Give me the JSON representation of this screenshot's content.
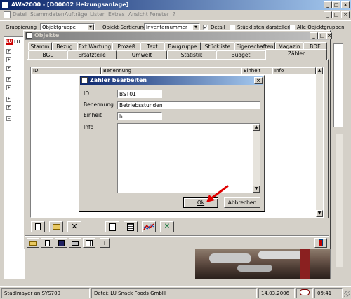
{
  "main_window": {
    "title": "AWa2000 - [D00002 Heizungsanlage]",
    "menu": [
      "Datei",
      "Stammdaten",
      "Aufträge",
      "Listen",
      "Extras",
      "Ansicht",
      "Fenster",
      "?"
    ],
    "toolbar": {
      "gruppierung_label": "Gruppierung",
      "gruppierung_value": "Objektgruppe",
      "sortierung_label": "Objekt-Sortierung",
      "sortierung_value": "Inventarnummer",
      "detail_label": "Detail",
      "stueckliste_label": "Stücklisten darstellen",
      "alle_label": "Alle Objektgruppen"
    },
    "tree_first": "LU"
  },
  "objekte_window": {
    "title": "Objekte",
    "tabs_row1": [
      "Stamm",
      "Bezug",
      "Ext.Wartung",
      "Prozeß",
      "Text",
      "Baugruppe",
      "Stückliste",
      "Eigenschaften",
      "Magazin",
      "BDE"
    ],
    "tabs_row2": [
      "BGL",
      "Ersatzteile",
      "Umwelt",
      "Statistik",
      "Budget",
      "Zähler"
    ],
    "active_tab": "Zähler",
    "columns": [
      "ID",
      "Benennung",
      "Einheit",
      "Info"
    ],
    "bottom_toolbar_info": "i"
  },
  "dialog": {
    "title": "Zähler bearbeiten",
    "id_label": "ID",
    "id_value": "BST01",
    "benennung_label": "Benennung",
    "benennung_value": "Betriebsstunden",
    "einheit_label": "Einheit",
    "einheit_value": "h",
    "info_label": "Info",
    "ok_label": "Ok",
    "cancel_label": "Abbrechen"
  },
  "status_bar": {
    "user": "Stadlmayer an SYS700",
    "file": "Datei: LU Snack Foods GmbH",
    "date": "14.03.2006",
    "time": "09:41"
  },
  "colors": {
    "title_active": "#0a246a",
    "face": "#d4d0c8",
    "arrow": "#e00000"
  }
}
